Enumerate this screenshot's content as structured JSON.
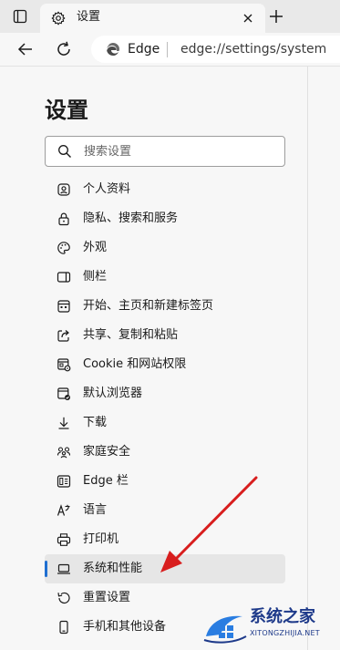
{
  "tab": {
    "title": "设置"
  },
  "address": {
    "brand": "Edge",
    "url": "edge://settings/system"
  },
  "page": {
    "title": "设置"
  },
  "search": {
    "placeholder": "搜索设置"
  },
  "menu": [
    {
      "label": "个人资料",
      "icon": "profile-icon"
    },
    {
      "label": "隐私、搜索和服务",
      "icon": "lock-icon"
    },
    {
      "label": "外观",
      "icon": "palette-icon"
    },
    {
      "label": "侧栏",
      "icon": "sidebar-icon"
    },
    {
      "label": "开始、主页和新建标签页",
      "icon": "home-grid-icon"
    },
    {
      "label": "共享、复制和粘贴",
      "icon": "share-icon"
    },
    {
      "label": "Cookie 和网站权限",
      "icon": "site-permissions-icon"
    },
    {
      "label": "默认浏览器",
      "icon": "default-browser-icon"
    },
    {
      "label": "下载",
      "icon": "download-icon"
    },
    {
      "label": "家庭安全",
      "icon": "family-icon"
    },
    {
      "label": "Edge 栏",
      "icon": "edge-bar-icon"
    },
    {
      "label": "语言",
      "icon": "language-icon"
    },
    {
      "label": "打印机",
      "icon": "printer-icon"
    },
    {
      "label": "系统和性能",
      "icon": "laptop-icon",
      "active": true
    },
    {
      "label": "重置设置",
      "icon": "reset-icon"
    },
    {
      "label": "手机和其他设备",
      "icon": "phone-icon"
    }
  ],
  "watermark": {
    "name": "系统之家",
    "domain": "XITONGZHIJIA.NET"
  },
  "colors": {
    "accent": "#1f6fd1",
    "arrow": "#d81e1e",
    "watermark": "#1e3a8a"
  }
}
